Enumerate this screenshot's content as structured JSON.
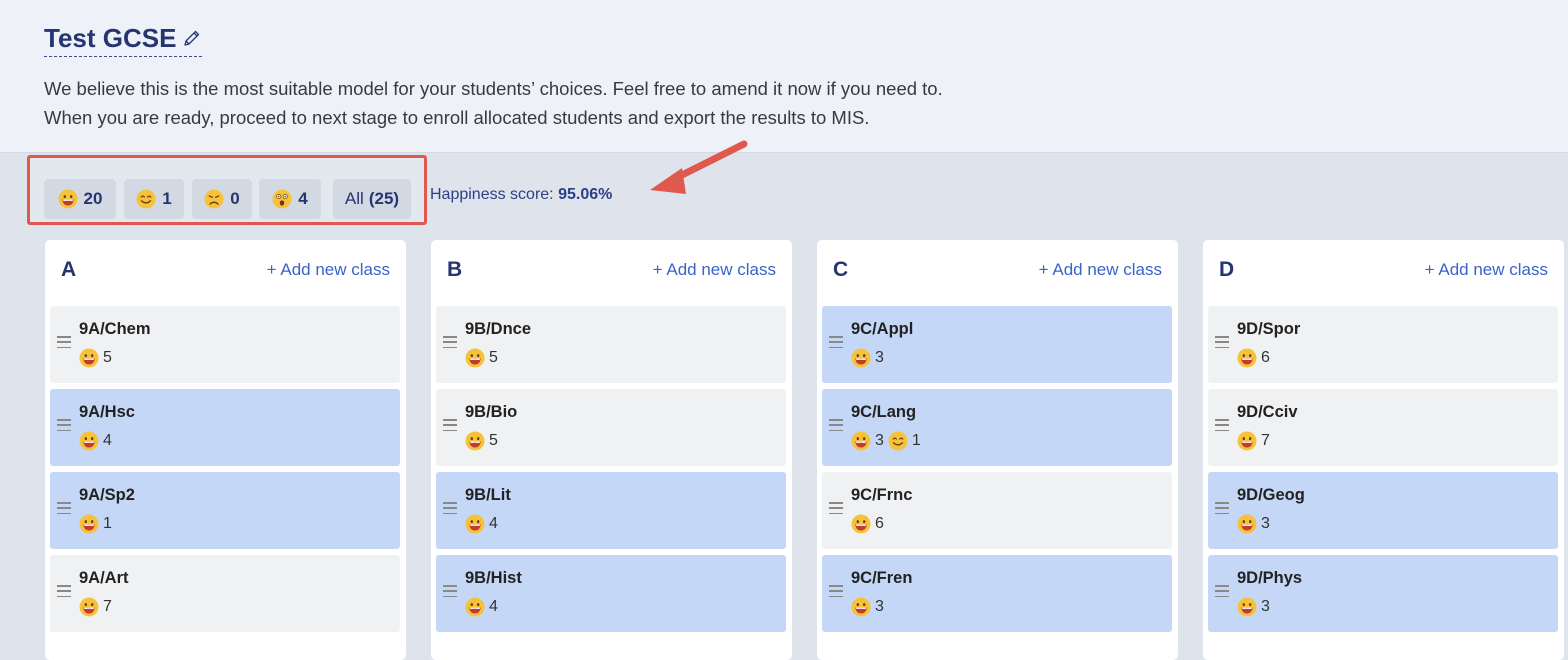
{
  "header": {
    "title": "Test GCSE",
    "desc_line1": "We believe this is the most suitable model for your students’ choices. Feel free to amend it now if you need to.",
    "desc_line2": "When you are ready, proceed to next stage to enroll allocated students and export the results to MIS."
  },
  "filters": {
    "very_happy": "20",
    "happy": "1",
    "sad": "0",
    "unallocated": "4",
    "all_label": "All",
    "all_count": "(25)"
  },
  "happiness": {
    "label": "Happiness score:",
    "value": "95.06%"
  },
  "add_class_label": "Add new class",
  "columns": [
    {
      "name": "A",
      "cards": [
        {
          "name": "9A/Chem",
          "v1": "5",
          "highlighted": false
        },
        {
          "name": "9A/Hsc",
          "v1": "4",
          "highlighted": true
        },
        {
          "name": "9A/Sp2",
          "v1": "1",
          "highlighted": true
        },
        {
          "name": "9A/Art",
          "v1": "7",
          "highlighted": false
        }
      ]
    },
    {
      "name": "B",
      "cards": [
        {
          "name": "9B/Dnce",
          "v1": "5",
          "highlighted": false
        },
        {
          "name": "9B/Bio",
          "v1": "5",
          "highlighted": false
        },
        {
          "name": "9B/Lit",
          "v1": "4",
          "highlighted": true
        },
        {
          "name": "9B/Hist",
          "v1": "4",
          "highlighted": true
        }
      ]
    },
    {
      "name": "C",
      "cards": [
        {
          "name": "9C/Appl",
          "v1": "3",
          "highlighted": true
        },
        {
          "name": "9C/Lang",
          "v1": "3",
          "v2": "1",
          "highlighted": true
        },
        {
          "name": "9C/Frnc",
          "v1": "6",
          "highlighted": false
        },
        {
          "name": "9C/Fren",
          "v1": "3",
          "highlighted": true
        }
      ]
    },
    {
      "name": "D",
      "cards": [
        {
          "name": "9D/Spor",
          "v1": "6",
          "highlighted": false
        },
        {
          "name": "9D/Cciv",
          "v1": "7",
          "highlighted": false
        },
        {
          "name": "9D/Geog",
          "v1": "3",
          "highlighted": true
        },
        {
          "name": "9D/Phys",
          "v1": "3",
          "highlighted": true
        }
      ]
    }
  ],
  "colors": {
    "accent": "#26346f",
    "link": "#3a63c9",
    "highlight_card": "#c5d7f6",
    "callout": "#e0594f"
  },
  "icons": {
    "very_happy": "grinning-face-icon",
    "happy": "smiling-face-icon",
    "sad": "sad-face-icon",
    "unallocated": "shocked-face-icon",
    "edit": "pencil-icon",
    "drag": "drag-handle-icon"
  }
}
